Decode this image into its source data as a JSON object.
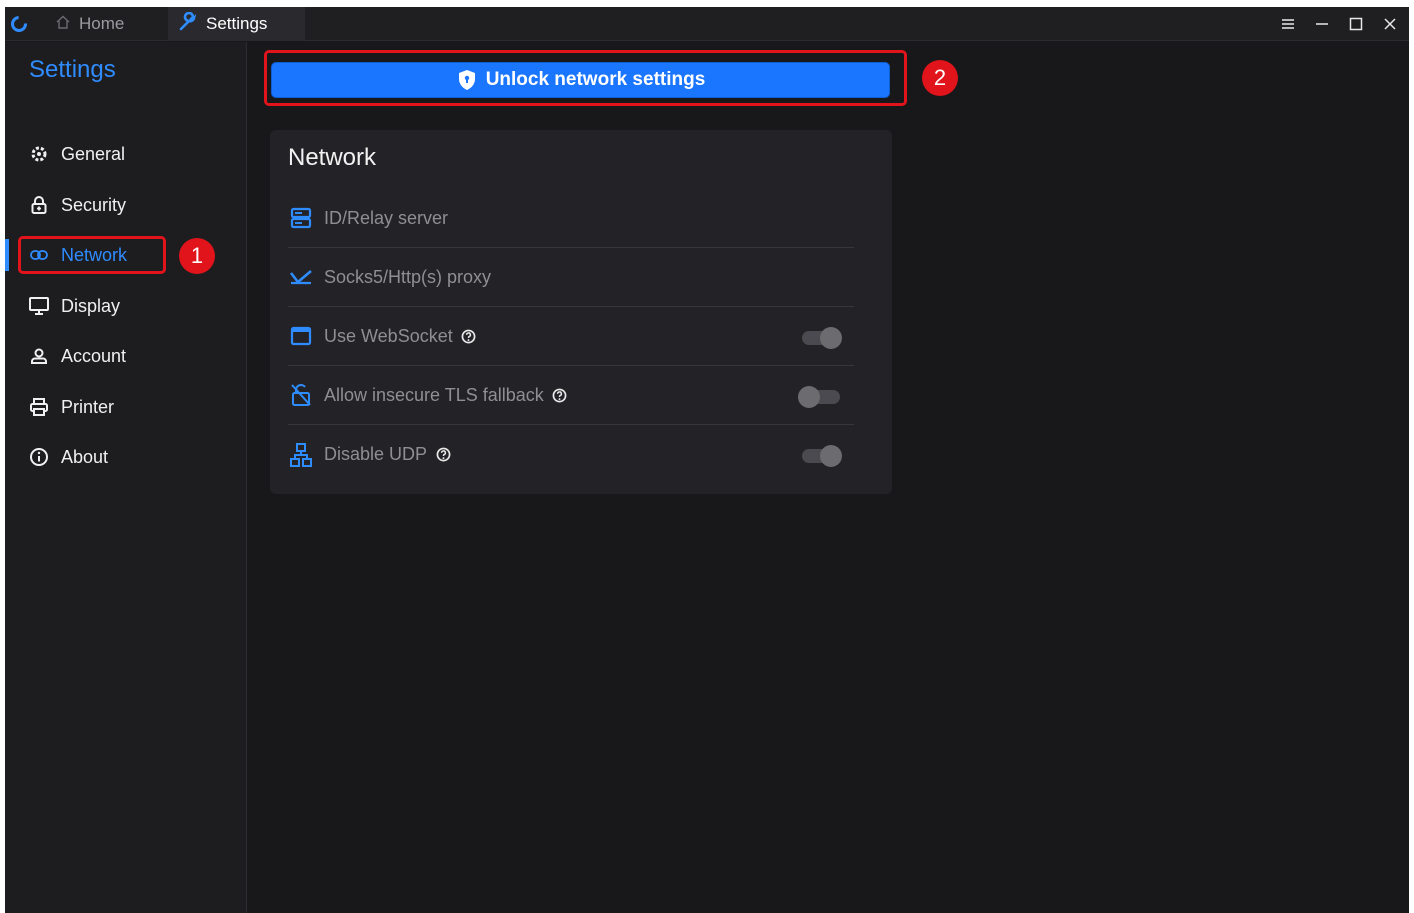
{
  "titlebar": {
    "tabs": [
      {
        "label": "Home",
        "icon": "home-icon"
      },
      {
        "label": "Settings",
        "icon": "wrench-icon"
      }
    ],
    "controls": [
      "menu-icon",
      "minimize-icon",
      "maximize-icon",
      "close-icon"
    ]
  },
  "sidebar": {
    "title": "Settings",
    "items": [
      {
        "label": "General",
        "icon": "gear-icon"
      },
      {
        "label": "Security",
        "icon": "lock-icon"
      },
      {
        "label": "Network",
        "icon": "link-icon",
        "active": true
      },
      {
        "label": "Display",
        "icon": "monitor-icon"
      },
      {
        "label": "Account",
        "icon": "user-icon"
      },
      {
        "label": "Printer",
        "icon": "printer-icon"
      },
      {
        "label": "About",
        "icon": "info-icon"
      }
    ]
  },
  "annotations": {
    "badge1": "1",
    "badge2": "2"
  },
  "main": {
    "unlock_button": "Unlock network settings",
    "network": {
      "title": "Network",
      "rows": [
        {
          "label": "ID/Relay server",
          "icon": "server-icon"
        },
        {
          "label": "Socks5/Http(s) proxy",
          "icon": "proxy-icon"
        },
        {
          "label": "Use WebSocket",
          "icon": "window-icon",
          "toggle": true,
          "on": true
        },
        {
          "label": "Allow insecure TLS fallback",
          "icon": "unsecure-lock-icon",
          "toggle": true,
          "on": false
        },
        {
          "label": "Disable UDP",
          "icon": "network-tree-icon",
          "toggle": true,
          "on": true
        }
      ]
    }
  },
  "colors": {
    "accent": "#2f8cff",
    "button": "#1a75ff",
    "highlight": "#e0141a",
    "background": "#18181a"
  }
}
